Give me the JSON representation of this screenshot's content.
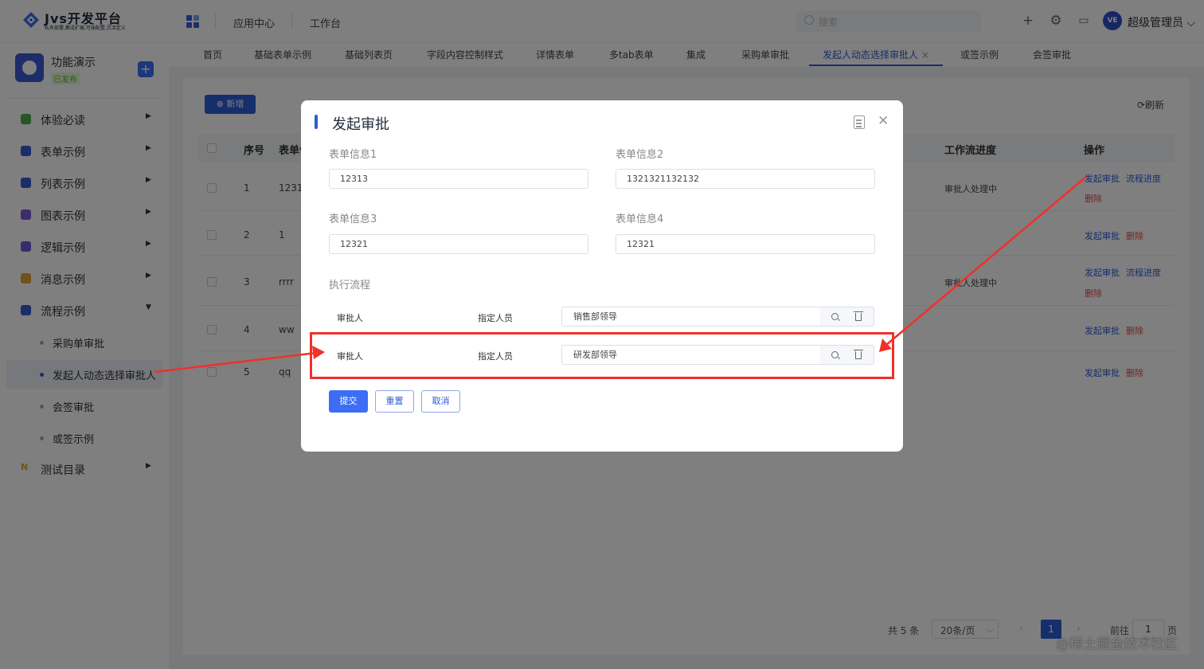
{
  "header": {
    "brand_title": "Jvs开发平台",
    "brand_subtitle": "私有部署,集成扩展,可插配置,灵活定义",
    "nav": [
      "应用中心",
      "工作台"
    ],
    "search_placeholder": "搜索",
    "avatar_text": "VE",
    "user_name": "超级管理员"
  },
  "sidebar": {
    "app_title": "功能演示",
    "app_status": "已发布",
    "add_label": "+",
    "menu": [
      {
        "label": "体验必读",
        "color": "#4caf50"
      },
      {
        "label": "表单示例",
        "color": "#3b5bd6"
      },
      {
        "label": "列表示例",
        "color": "#3b5bd6"
      },
      {
        "label": "图表示例",
        "color": "#7b5bd6"
      },
      {
        "label": "逻辑示例",
        "color": "#6b5bd6"
      },
      {
        "label": "消息示例",
        "color": "#e6a23c"
      },
      {
        "label": "流程示例",
        "color": "#3b5bd6"
      }
    ],
    "sub_items": [
      "采购单审批",
      "发起人动态选择审批人",
      "会签审批",
      "或签示例"
    ],
    "extra_item": {
      "label": "测试目录",
      "color": "#e6a23c"
    }
  },
  "tabs": [
    "首页",
    "基础表单示例",
    "基础列表页",
    "字段内容控制样式",
    "详情表单",
    "多tab表单",
    "集成",
    "采购单审批",
    "发起人动态选择审批人",
    "或签示例",
    "会签审批"
  ],
  "active_tab_close": "×",
  "toolbar": {
    "new_label": "⊕ 新增",
    "refresh_label": "⟳刷新"
  },
  "table": {
    "headers": {
      "index": "序号",
      "form": "表单信",
      "progress": "工作流进度",
      "actions": "操作"
    },
    "rows": [
      {
        "index": "1",
        "value": "1231",
        "progress": "审批人处理中",
        "actions": [
          "发起审批",
          "流程进度",
          "删除"
        ]
      },
      {
        "index": "2",
        "value": "1",
        "progress": "",
        "actions": [
          "发起审批",
          "删除"
        ]
      },
      {
        "index": "3",
        "value": "rrrr",
        "progress": "审批人处理中",
        "actions": [
          "发起审批",
          "流程进度",
          "删除"
        ]
      },
      {
        "index": "4",
        "value": "ww",
        "progress": "",
        "actions": [
          "发起审批",
          "删除"
        ]
      },
      {
        "index": "5",
        "value": "qq",
        "progress": "",
        "actions": [
          "发起审批",
          "删除"
        ]
      }
    ]
  },
  "pagination": {
    "total": "共 5 条",
    "page_size": "20条/页",
    "current": "1",
    "goto_prefix": "前往",
    "goto_value": "1",
    "goto_suffix": "页"
  },
  "watermark": "@稀土掘金技术社区",
  "modal": {
    "title": "发起审批",
    "fields": [
      {
        "label": "表单信息1",
        "value": "12313"
      },
      {
        "label": "表单信息2",
        "value": "1321321132132"
      },
      {
        "label": "表单信息3",
        "value": "12321"
      },
      {
        "label": "表单信息4",
        "value": "12321"
      }
    ],
    "flow_title": "执行流程",
    "flow_rows": [
      {
        "role": "审批人",
        "type": "指定人员",
        "value": "销售部领导"
      },
      {
        "role": "审批人",
        "type": "指定人员",
        "value": "研发部领导"
      }
    ],
    "buttons": {
      "submit": "提交",
      "reset": "重置",
      "cancel": "取消"
    }
  },
  "colors": {
    "primary": "#2c5cd6",
    "danger": "#e54848",
    "annotation": "#f0302a",
    "success": "#52c41a"
  }
}
